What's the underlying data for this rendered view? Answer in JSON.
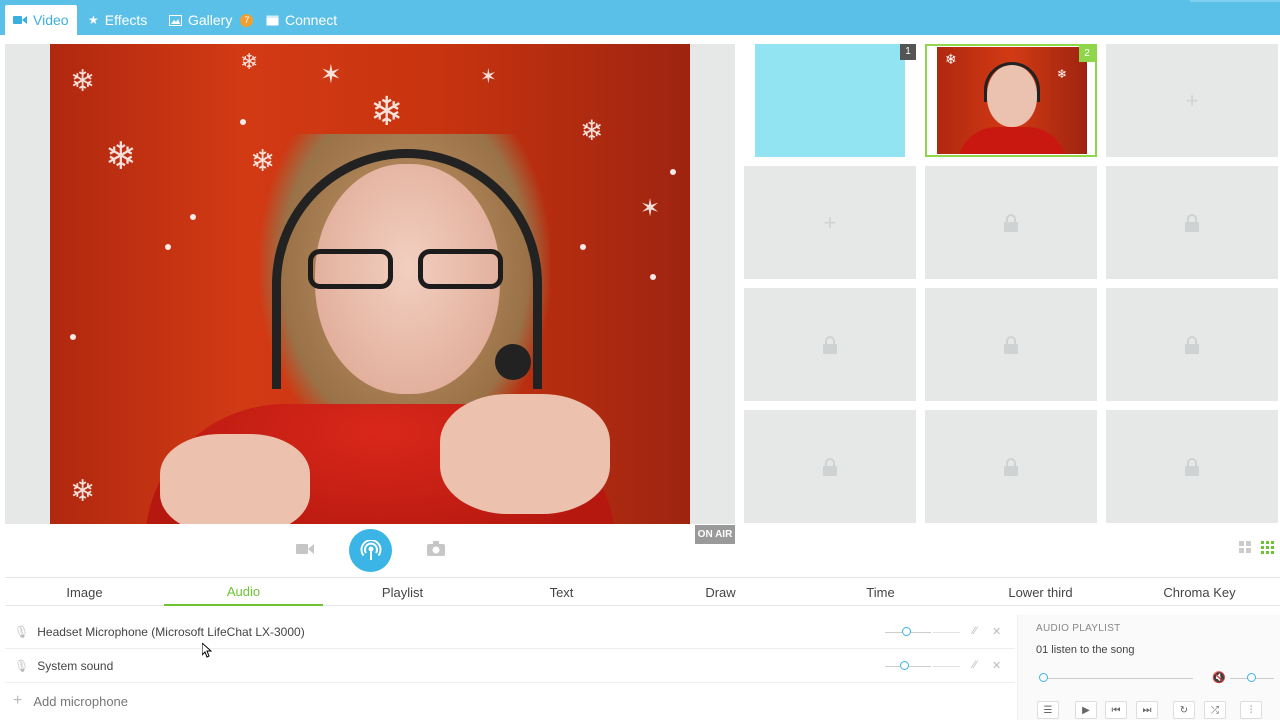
{
  "topbar": {
    "tabs": [
      {
        "label": "Video",
        "icon": "video-camera-icon"
      },
      {
        "label": "Effects",
        "icon": "star-icon"
      },
      {
        "label": "Gallery",
        "icon": "image-icon",
        "badge": "7"
      },
      {
        "label": "Connect",
        "icon": "window-icon"
      }
    ],
    "active_tab": "Video"
  },
  "preview": {
    "on_air_label": "ON AIR"
  },
  "scenes": [
    {
      "number": "1",
      "type": "blue-screen"
    },
    {
      "number": "2",
      "type": "camera",
      "active": true
    },
    {
      "type": "add"
    },
    {
      "type": "add"
    },
    {
      "type": "locked"
    },
    {
      "type": "locked"
    },
    {
      "type": "locked"
    },
    {
      "type": "locked"
    },
    {
      "type": "locked"
    },
    {
      "type": "locked"
    },
    {
      "type": "locked"
    },
    {
      "type": "locked"
    }
  ],
  "tool_tabs": [
    "Image",
    "Audio",
    "Playlist",
    "Text",
    "Draw",
    "Time",
    "Lower third",
    "Chroma Key"
  ],
  "active_tool_tab": "Audio",
  "audio": {
    "sources": [
      {
        "label": "Headset Microphone (Microsoft LifeChat LX-3000)",
        "volume": 0.45
      },
      {
        "label": "System sound",
        "volume": 0.4
      }
    ],
    "add_label": "Add microphone"
  },
  "playlist": {
    "title": "AUDIO PLAYLIST",
    "song": "01 listen to the song",
    "position": 0.0,
    "volume": 0.8
  },
  "colors": {
    "topbar": "#5bc0e8",
    "accent_blue": "#3bb4e6",
    "accent_green": "#6cc432",
    "badge": "#f0a030"
  }
}
